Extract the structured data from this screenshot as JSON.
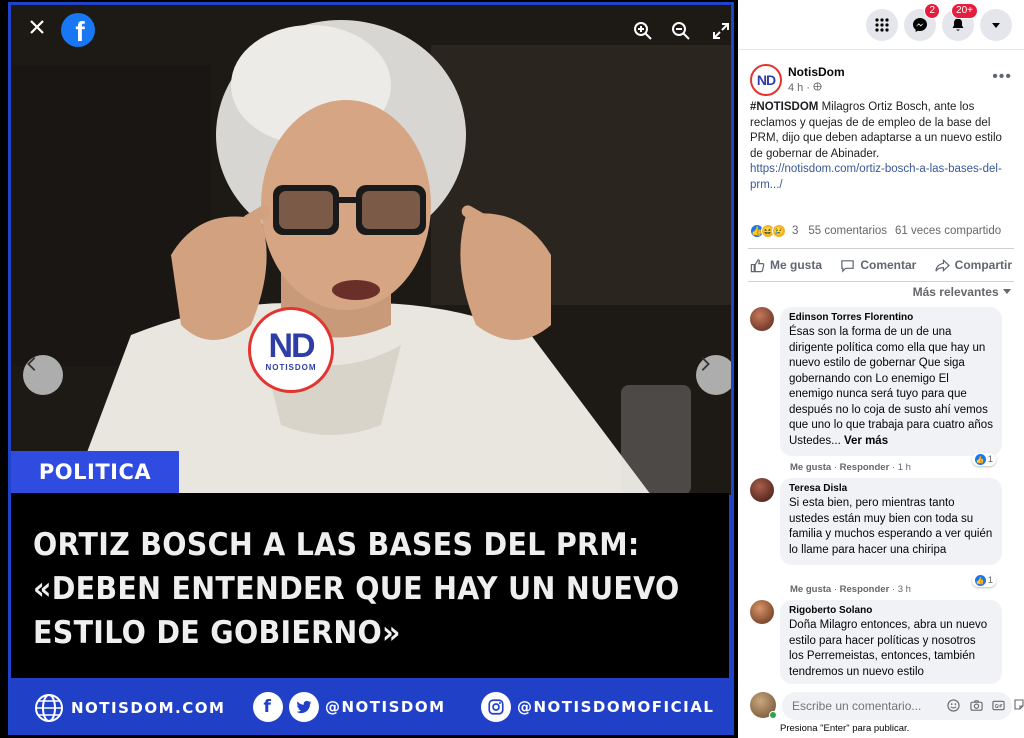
{
  "viewer": {
    "close_icon": "close-icon",
    "brand_letter": "f",
    "category": "POLITICA",
    "headline": "ORTIZ BOSCH A LAS BASES DEL PRM: «DEBEN ENTENDER QUE HAY UN NUEVO ESTILO DE GOBIERNO»",
    "watermark_nd": "ND",
    "watermark_sub": "NOTISDOM",
    "footer": {
      "website": "NOTISDOM.COM",
      "social_handle": "@NOTISDOM",
      "instagram_handle": "@NOTISDOMOFICIAL"
    }
  },
  "topbar": {
    "messenger_badge": "2",
    "notifications_badge": "20+"
  },
  "post": {
    "page_avatar_text": "ND",
    "page_name": "NotisDom",
    "time": "4 h · ",
    "hashtag": "#NOTISDOM",
    "body": " Milagros Ortiz Bosch, ante los reclamos y quejas de de empleo de la base del PRM, dijo que deben adaptarse a un nuevo estilo de gobernar de Abinader.",
    "link": "https://notisdom.com/ortiz-bosch-a-las-bases-del-prm.../",
    "reaction_count": "3",
    "comments_count": "55 comentarios",
    "shares_count": "61 veces compartido",
    "like_label": "Me gusta",
    "comment_label": "Comentar",
    "share_label": "Compartir",
    "sort_label": "Más relevantes"
  },
  "comments": [
    {
      "name": "Edinson Torres Florentino",
      "text": "Ésas son la forma de un de una dirigente política como ella que hay un nuevo estilo de gobernar Que siga gobernando con Lo enemigo El enemigo nunca será tuyo para que después no lo coja de susto ahí vemos que uno lo que trabaja para cuatro años Ustedes... ",
      "more": "Ver más",
      "like": "Me gusta",
      "reply": "Responder",
      "time": "1 h",
      "likes": "1",
      "avatar_color": "#8a3b2b"
    },
    {
      "name": "Teresa Disla",
      "text": "Si esta bien, pero mientras tanto ustedes están muy bien con toda su familia y muchos esperando a ver quién lo llame para hacer una chiripa",
      "like": "Me gusta",
      "reply": "Responder",
      "time": "3 h",
      "likes": "1",
      "avatar_color": "#6e2a22"
    },
    {
      "name": "Rigoberto Solano",
      "text": "Doña Milagro entonces, abra un nuevo estilo para hacer políticas y nosotros los Perremeistas, entonces, también tendremos un nuevo estilo",
      "avatar_color": "#9c5a3a"
    }
  ],
  "composer": {
    "placeholder": "Escribe un comentario...",
    "hint": "Presiona \"Enter\" para publicar."
  },
  "colors": {
    "frame_blue": "#1f43c9",
    "tag_blue": "#2f4be0",
    "footer_blue": "#2140c8",
    "facebook_blue": "#1877f2",
    "nd_red": "#e3342f"
  }
}
